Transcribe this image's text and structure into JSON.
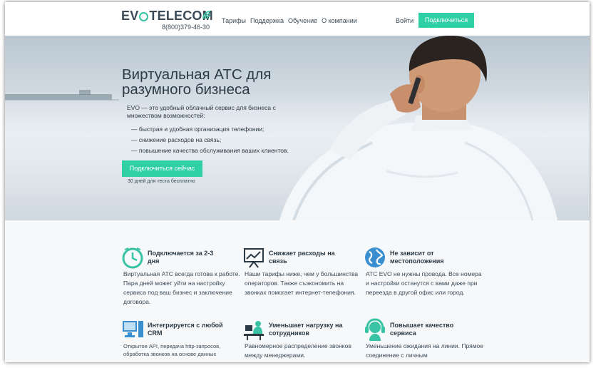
{
  "header": {
    "logo_left": "EV",
    "logo_right": "TELECOM",
    "phone": "8(800)379-46-30",
    "nav": [
      "Тарифы",
      "Поддержка",
      "Обучение",
      "О компании"
    ],
    "login": "Войти",
    "connect": "Подключиться"
  },
  "hero": {
    "title": "Виртуальная АТС для разумного бизнеса",
    "description": "EVO — это удобный облачный сервис для бизнеса с множеством возможностей:",
    "bullets": [
      "— быстрая и удобная организация телефонии;",
      "— снижение расходов на связь;",
      "— повышение качества обслуживания ваших клиентов."
    ],
    "cta": "Подключиться сейчас",
    "trial": "30 дней для теста бесплатно"
  },
  "features": [
    {
      "title": "Подключается за 2-3 дня",
      "text": "Виртуальная АТС всегда готова к работе. Пара дней может уйти  на настройку сервиса под ваш бизнес и заключение договора.",
      "icon": "clock-icon"
    },
    {
      "title": "Снижает расходы на связь",
      "text": "Наши тарифы ниже, чем у большинства операторов. Также съэкономить на звонках помогает интернет-телефония.",
      "icon": "presentation-chart-icon"
    },
    {
      "title": "Не зависит от местоположения",
      "text": "АТС EVO не нужны провода. Все номера и настройки останутся с вами даже при переезда в другой офис или город.",
      "icon": "globe-icon"
    },
    {
      "title": "Интегрируется с любой CRM",
      "text": "Открытое API, передача http-запросов, обработка звонков на основе данных",
      "icon": "computer-icon"
    },
    {
      "title": "Уменьшает нагрузку на сотрудников",
      "text": "Равномерное распределение звонков между менеджерами.",
      "icon": "operator-desk-icon"
    },
    {
      "title": "Повышает качество сервиса",
      "text": "Уменьшение ожидания на линии. Прямое соединение с личным",
      "icon": "headset-icon"
    }
  ],
  "colors": {
    "accent": "#2fd0a6",
    "text": "#2c3a45",
    "icon_blue": "#3a8fd0",
    "icon_teal": "#38c3a4"
  }
}
